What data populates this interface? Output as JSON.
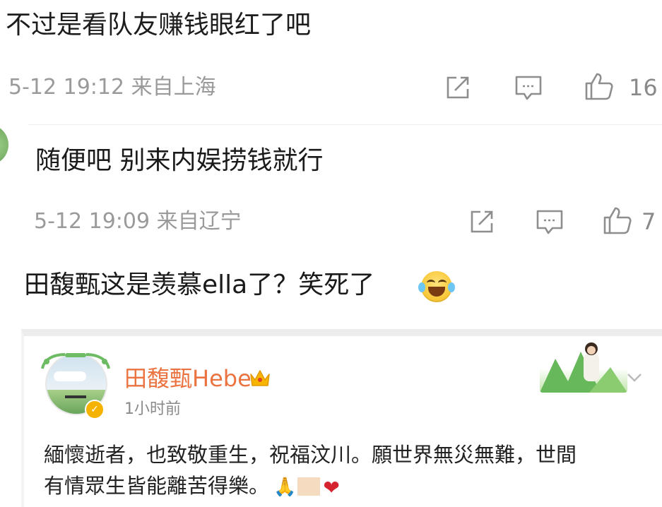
{
  "comments": [
    {
      "text": "不过是看队友赚钱眼红了吧",
      "time": "5-12 19:12 来自上海",
      "likes": "16"
    },
    {
      "text": "随便吧 别来内娱捞钱就行",
      "time": "5-12 19:09 来自辽宁",
      "likes": "7"
    },
    {
      "text": "田馥甄这是羡慕ella了？笑死了"
    }
  ],
  "quoted_post": {
    "author": "田馥甄Hebe",
    "time": "1小时前",
    "line1": "緬懷逝者，也致敬重生，祝福汶川。願世界無災無難，世間",
    "line2": "有情眾生皆能離苦得樂。",
    "badge": "✓",
    "heart": "❤",
    "hands": "🙏"
  },
  "icons": {
    "share": "share-icon",
    "comment": "comment-icon",
    "like": "thumbs-up-icon",
    "laugh": "laughing-crying-emoji-icon",
    "crown": "crown-icon",
    "chevron": "chevron-down-icon"
  },
  "colors": {
    "author_name": "#eb7340",
    "meta_text": "#9a9a9a",
    "verified_badge": "#f5b300",
    "heart": "#d5232f"
  }
}
